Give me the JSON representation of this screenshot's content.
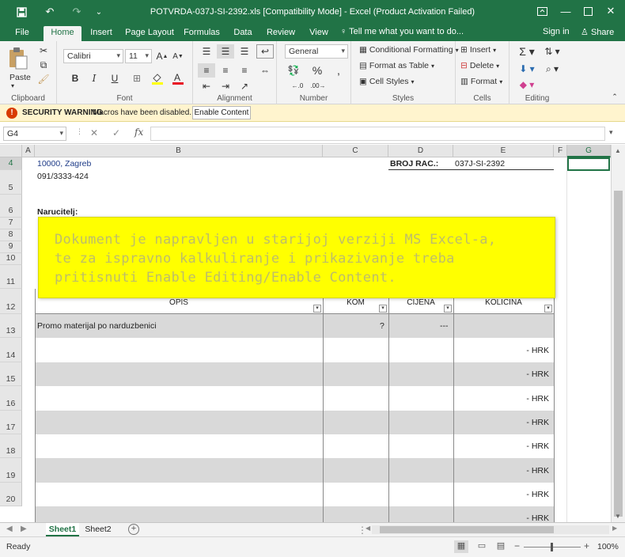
{
  "titlebar": {
    "title": "POTVRDA-037J-SI-2392.xls  [Compatibility Mode] - Excel (Product Activation Failed)",
    "save_icon": "save-icon",
    "undo_icon": "undo-icon",
    "redo_icon": "redo-icon",
    "minimize": "—",
    "restore": "❐",
    "maximize": "☐",
    "close": "✕"
  },
  "tabs": {
    "items": [
      "File",
      "Home",
      "Insert",
      "Page Layout",
      "Formulas",
      "Data",
      "Review",
      "View"
    ],
    "active": "Home",
    "tell_me": "Tell me what you want to do...",
    "sign_in": "Sign in",
    "share": "Share"
  },
  "ribbon": {
    "clipboard": {
      "label": "Clipboard",
      "paste": "Paste"
    },
    "font": {
      "label": "Font",
      "name": "Calibri",
      "size": "11"
    },
    "alignment": {
      "label": "Alignment"
    },
    "number": {
      "label": "Number",
      "format": "General"
    },
    "styles": {
      "label": "Styles",
      "conditional": "Conditional Formatting",
      "table": "Format as Table",
      "cell_styles": "Cell Styles"
    },
    "cells": {
      "label": "Cells",
      "insert": "Insert",
      "delete": "Delete",
      "format": "Format"
    },
    "editing": {
      "label": "Editing"
    }
  },
  "security": {
    "title": "SECURITY WARNING",
    "message": "Macros have been disabled.",
    "button": "Enable Content"
  },
  "formula_bar": {
    "name_box": "G4",
    "formula": ""
  },
  "grid": {
    "columns": [
      "A",
      "B",
      "C",
      "D",
      "E",
      "F",
      "G"
    ],
    "selected_column": "G",
    "rows": [
      "4",
      "5",
      "6",
      "7",
      "8",
      "9",
      "10",
      "11",
      "12",
      "13",
      "14",
      "15",
      "16",
      "17",
      "18",
      "19",
      "20"
    ],
    "cells": {
      "b4": "10000, Zagreb",
      "b5": "091/3333-424",
      "b6": "Narucitelj:",
      "d4": "BROJ RAC.:",
      "e4": "037J-SI-2392",
      "b13": "Promo materijal po narduzbenici",
      "c13": "?",
      "d13": "---"
    },
    "table_headers": {
      "opis": "OPIS",
      "kom": "KOM",
      "cijena": "CIJENA",
      "kolicina": "KOLICINA"
    },
    "hrk_values": [
      "- HRK",
      "- HRK",
      "- HRK",
      "- HRK",
      "- HRK",
      "- HRK",
      "- HRK",
      "- HRK"
    ]
  },
  "overlay": {
    "lines": [
      "Dokument je napravljen u starijoj verziji MS Excel-a,",
      "te za ispravno kalkuliranje i prikazivanje treba",
      "pritisnuti Enable Editing/Enable Content."
    ],
    "background": "#ffff00"
  },
  "sheets": {
    "tabs": [
      "Sheet1",
      "Sheet2"
    ],
    "active": "Sheet1"
  },
  "status": {
    "text": "Ready",
    "zoom": "100%"
  },
  "colors": {
    "excel_green": "#217346",
    "warning_bar": "#fff4ce"
  }
}
